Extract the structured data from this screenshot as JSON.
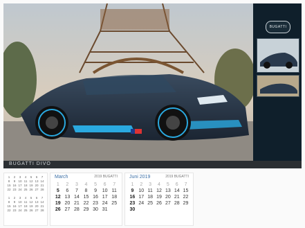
{
  "photo": {
    "caption": "BUGATTI DIVO"
  },
  "brand": {
    "logo_text": "BUGATTI"
  },
  "calendar": {
    "mid_month": "March",
    "mid_year": "2019 BUGATTI",
    "right_month": "Juni 2019",
    "right_year": "2019 BUGATTI"
  },
  "colors": {
    "accent": "#3b6fa6",
    "side_panel": "#0f1f2b",
    "car_body": "#2a3a4d",
    "car_accent": "#2aa9e0"
  }
}
